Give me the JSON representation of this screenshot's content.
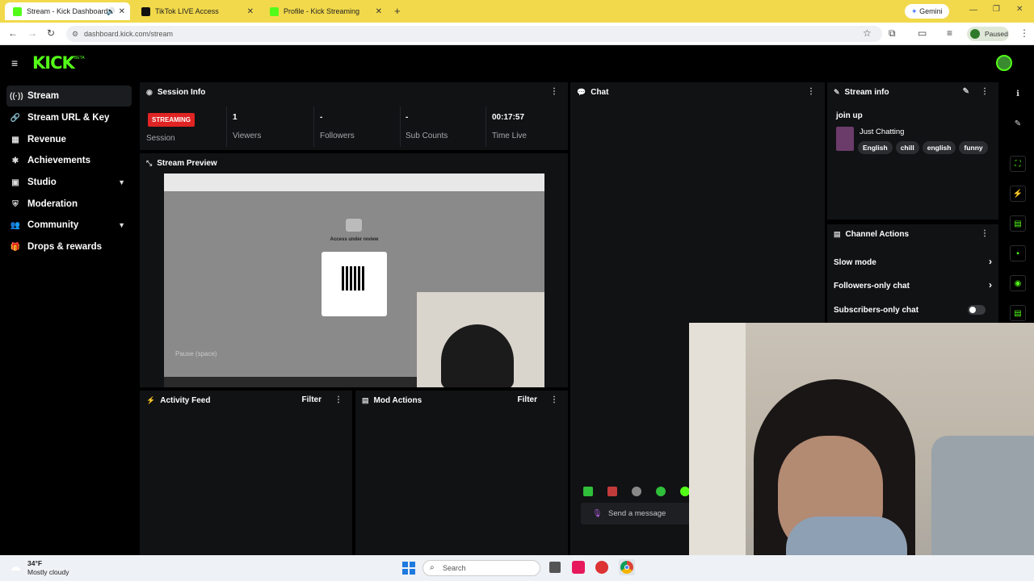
{
  "browser": {
    "tabs": [
      {
        "title": "Stream - Kick Dashboard",
        "color": "#53fc18",
        "active": true
      },
      {
        "title": "TikTok LIVE Access",
        "color": "#111111",
        "active": false
      },
      {
        "title": "Profile - Kick Streaming",
        "color": "#53fc18",
        "active": false
      }
    ],
    "gemini_label": "Gemini",
    "url": "dashboard.kick.com/stream",
    "profile_status": "Paused"
  },
  "app": {
    "logo_text": "KICK",
    "logo_sup": "BETA",
    "sidebar": {
      "items": [
        {
          "label": "Stream",
          "icon": "broadcast-icon",
          "active": true,
          "expandable": false
        },
        {
          "label": "Stream URL & Key",
          "icon": "link-icon",
          "active": false,
          "expandable": false
        },
        {
          "label": "Revenue",
          "icon": "money-icon",
          "active": false,
          "expandable": false
        },
        {
          "label": "Achievements",
          "icon": "star-icon",
          "active": false,
          "expandable": false
        },
        {
          "label": "Studio",
          "icon": "studio-icon",
          "active": false,
          "expandable": true
        },
        {
          "label": "Moderation",
          "icon": "shield-icon",
          "active": false,
          "expandable": false
        },
        {
          "label": "Community",
          "icon": "people-icon",
          "active": false,
          "expandable": true
        },
        {
          "label": "Drops & rewards",
          "icon": "gift-icon",
          "active": false,
          "expandable": false
        }
      ]
    },
    "session_info": {
      "title": "Session Info",
      "status_badge": "STREAMING",
      "session_label": "Session",
      "stats": [
        {
          "value": "1",
          "label": "Viewers"
        },
        {
          "value": "-",
          "label": "Followers"
        },
        {
          "value": "-",
          "label": "Sub Counts"
        },
        {
          "value": "00:17:57",
          "label": "Time Live"
        }
      ]
    },
    "stream_preview": {
      "title": "Stream Preview",
      "inner_heading": "Access under review",
      "pause_tooltip": "Pause (space)"
    },
    "activity_feed": {
      "title": "Activity Feed",
      "filter_label": "Filter"
    },
    "mod_actions": {
      "title": "Mod Actions",
      "filter_label": "Filter"
    },
    "chat": {
      "title": "Chat",
      "input_placeholder": "Send a message"
    },
    "stream_info": {
      "title": "Stream info",
      "stream_title": "join up",
      "category": "Just Chatting",
      "tags": [
        "English",
        "chill",
        "english",
        "funny"
      ]
    },
    "channel_actions": {
      "title": "Channel Actions",
      "actions": [
        {
          "label": "Slow mode",
          "type": "chevron"
        },
        {
          "label": "Followers-only chat",
          "type": "chevron"
        },
        {
          "label": "Subscribers-only chat",
          "type": "toggle",
          "enabled": false
        }
      ]
    }
  },
  "taskbar": {
    "weather_temp": "34°F",
    "weather_desc": "Mostly cloudy",
    "search_placeholder": "Search"
  }
}
